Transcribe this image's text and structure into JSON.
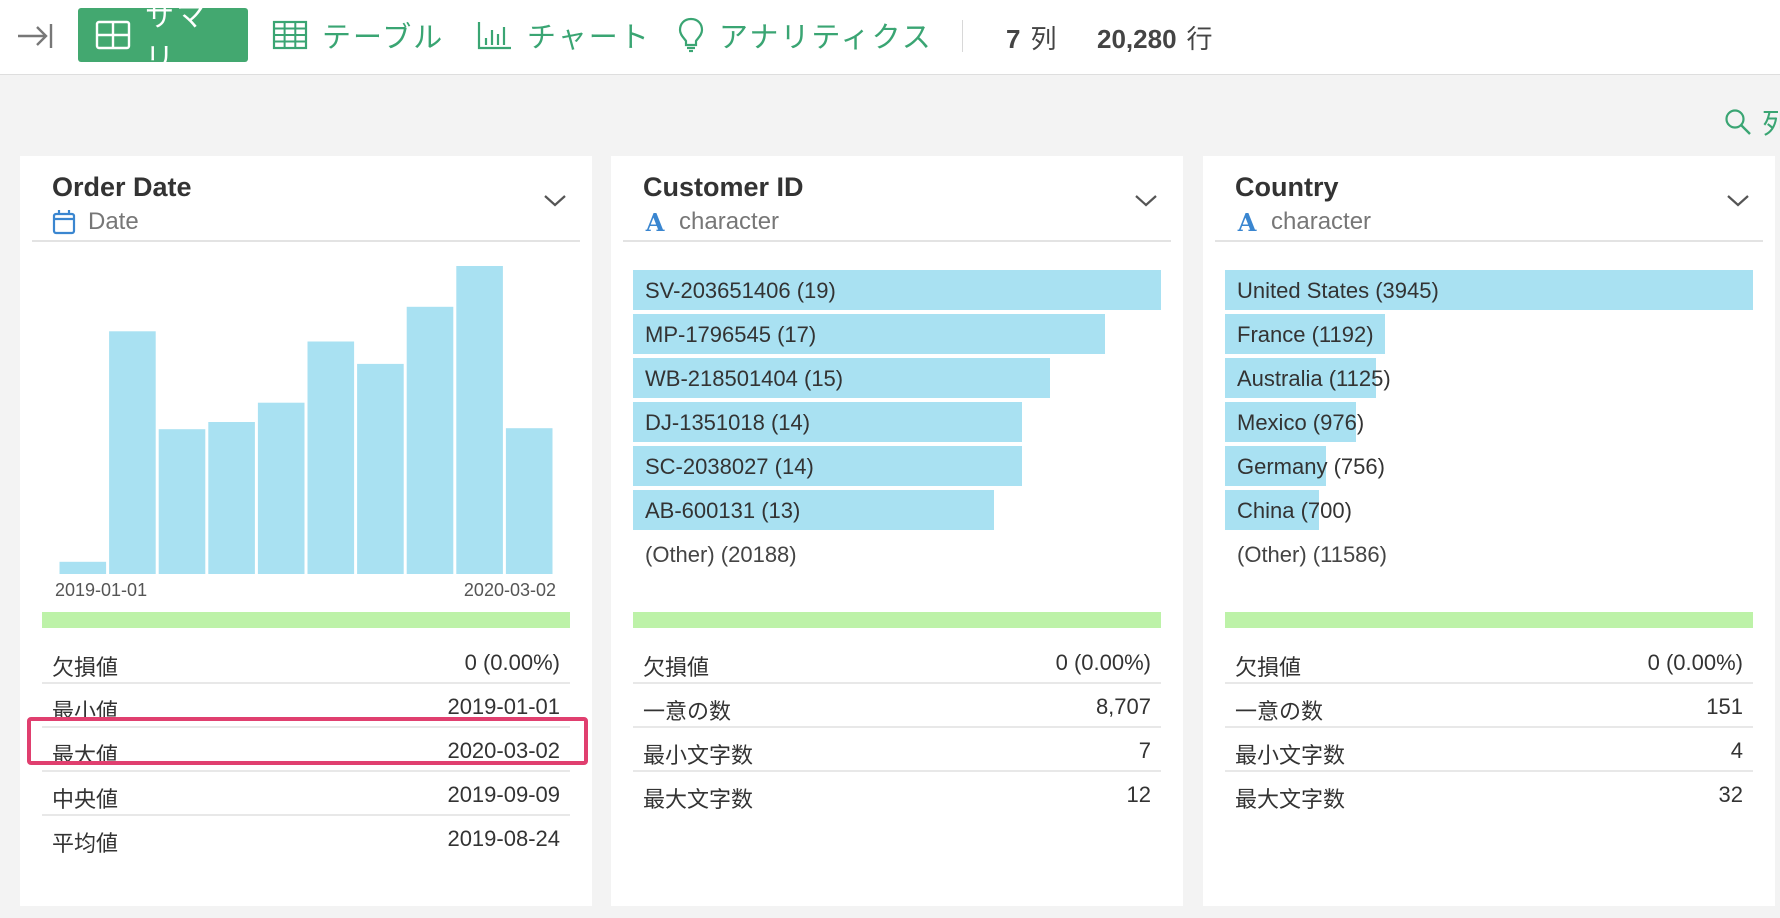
{
  "toolbar": {
    "tabs": [
      {
        "label": "サマリ",
        "icon": "summary-grid-icon",
        "active": true
      },
      {
        "label": "テーブル",
        "icon": "table-icon",
        "active": false
      },
      {
        "label": "チャート",
        "icon": "bar-chart-icon",
        "active": false
      },
      {
        "label": "アナリティクス",
        "icon": "lightbulb-icon",
        "active": false
      }
    ],
    "columns_count": "7",
    "columns_unit": "列",
    "rows_count": "20,280",
    "rows_unit": "行"
  },
  "search": {
    "label": "列",
    "icon": "search-icon"
  },
  "colors": {
    "accent": "#43a870",
    "bar": "#a9e1f2",
    "quality": "#bdf2a8",
    "highlight": "#e03f6f"
  },
  "cards": [
    {
      "name": "Order Date",
      "type": "Date",
      "type_icon": "calendar-icon",
      "histogram": {
        "values": [
          12,
          238,
          142,
          149,
          168,
          228,
          206,
          262,
          302,
          143
        ],
        "x_start": "2019-01-01",
        "x_end": "2020-03-02"
      },
      "stats": [
        {
          "label": "欠損値",
          "value": "0 (0.00%)"
        },
        {
          "label": "最小値",
          "value": "2019-01-01"
        },
        {
          "label": "最大値",
          "value": "2020-03-02"
        },
        {
          "label": "中央値",
          "value": "2019-09-09"
        },
        {
          "label": "平均値",
          "value": "2019-08-24"
        }
      ]
    },
    {
      "name": "Customer ID",
      "type": "character",
      "type_icon": "character-icon",
      "type_letter": "A",
      "top_values": [
        {
          "label": "SV-203651406 (19)",
          "count": 19
        },
        {
          "label": "MP-1796545 (17)",
          "count": 17
        },
        {
          "label": "WB-218501404 (15)",
          "count": 15
        },
        {
          "label": "DJ-1351018 (14)",
          "count": 14
        },
        {
          "label": "SC-2038027 (14)",
          "count": 14
        },
        {
          "label": "AB-600131 (13)",
          "count": 13
        }
      ],
      "other": "(Other) (20188)",
      "stats": [
        {
          "label": "欠損値",
          "value": "0 (0.00%)"
        },
        {
          "label": "一意の数",
          "value": "8,707"
        },
        {
          "label": "最小文字数",
          "value": "7"
        },
        {
          "label": "最大文字数",
          "value": "12"
        }
      ]
    },
    {
      "name": "Country",
      "type": "character",
      "type_icon": "character-icon",
      "type_letter": "A",
      "top_values": [
        {
          "label": "United States (3945)",
          "count": 3945
        },
        {
          "label": "France (1192)",
          "count": 1192
        },
        {
          "label": "Australia (1125)",
          "count": 1125
        },
        {
          "label": "Mexico (976)",
          "count": 976
        },
        {
          "label": "Germany (756)",
          "count": 756
        },
        {
          "label": "China (700)",
          "count": 700
        }
      ],
      "other": "(Other) (11586)",
      "stats": [
        {
          "label": "欠損値",
          "value": "0 (0.00%)"
        },
        {
          "label": "一意の数",
          "value": "151"
        },
        {
          "label": "最小文字数",
          "value": "4"
        },
        {
          "label": "最大文字数",
          "value": "32"
        }
      ]
    }
  ]
}
